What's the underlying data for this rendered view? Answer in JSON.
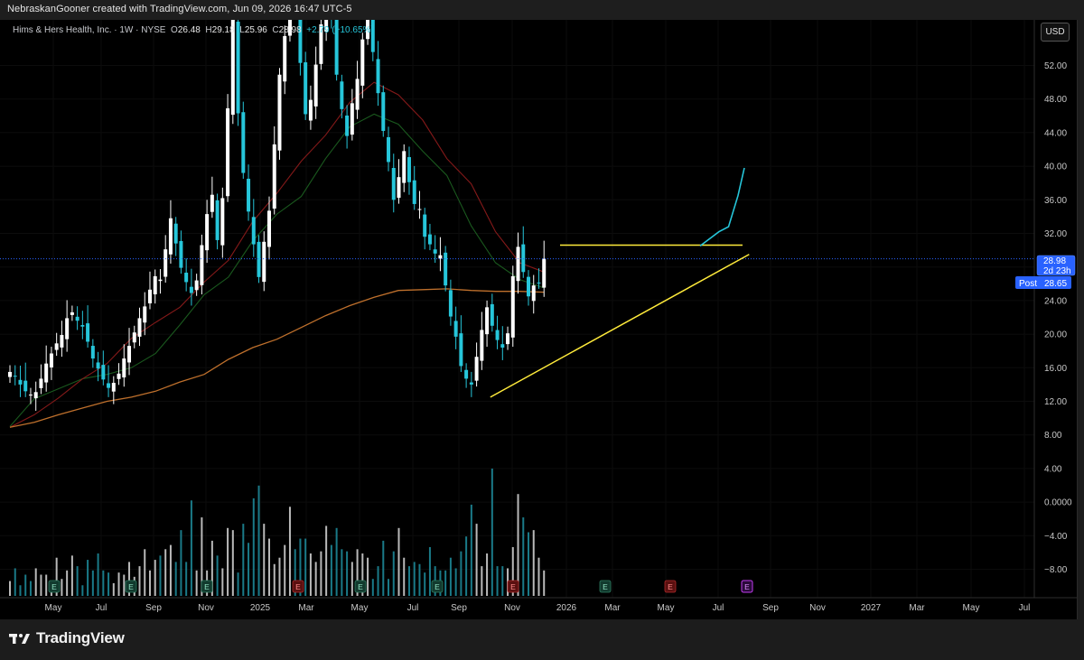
{
  "caption": "NebraskanGooner created with TradingView.com, Jun 09, 2026 16:47 UTC-5",
  "legend": {
    "symbol": "Hims & Hers Health, Inc. · 1W · NYSE",
    "o_label": "O",
    "o": "26.48",
    "h_label": "H",
    "h": "29.18",
    "l_label": "L",
    "l": "25.96",
    "c_label": "C",
    "c": "28.98",
    "change": "+2.79 (+10.65%)"
  },
  "currency_button": "USD",
  "brand": "TradingView",
  "colors": {
    "up_candle": "#ffffff",
    "down_candle": "#26c6da",
    "ema_fast": "#1b5e20",
    "ema_mid": "#8b1a1a",
    "ma_slow": "#c9762e",
    "trendline": "#ffeb3b",
    "projection": "#26c6da",
    "last_price_line": "#2962ff",
    "post_tag": "#2962ff"
  },
  "price_tags": {
    "last": "28.98",
    "countdown": "2d 23h",
    "post_label": "Post",
    "post": "28.65"
  },
  "earnings_marker": "E",
  "chart_data": {
    "type": "candlestick",
    "interval": "1W",
    "y_axis_ticks": [
      "52.00",
      "48.00",
      "44.00",
      "40.00",
      "36.00",
      "32.00",
      "28.00",
      "24.00",
      "20.00",
      "16.00",
      "12.00",
      "8.00",
      "4.00",
      "0.0000",
      "−4.00",
      "−8.00"
    ],
    "x_axis_ticks": [
      "May",
      "Jul",
      "Sep",
      "Nov",
      "2025",
      "Mar",
      "May",
      "Jul",
      "Sep",
      "Nov",
      "2026",
      "Mar",
      "May",
      "Jul",
      "Sep",
      "Nov",
      "2027",
      "Mar",
      "May",
      "Jul"
    ],
    "ylim": [
      6,
      56
    ],
    "last_close": 28.98,
    "post_market": 28.65,
    "resistance_level": 30.6,
    "support_trendline": [
      {
        "week": 93,
        "price": 12.5
      },
      {
        "week": 118,
        "price": 29.5
      }
    ],
    "projection_path": [
      [
        111,
        30.5
      ],
      [
        114,
        32.2
      ],
      [
        115.5,
        32.8
      ],
      [
        117,
        36.5
      ],
      [
        118,
        39.8
      ]
    ],
    "weekly_closes": [
      15.5,
      15.0,
      14.0,
      13.2,
      12.8,
      13.1,
      14.7,
      16.5,
      17.7,
      18.9,
      19.9,
      21.9,
      22.6,
      21.6,
      20.9,
      19.1,
      17.1,
      15.9,
      14.6,
      13.6,
      14.2,
      15.3,
      17.1,
      18.6,
      20.2,
      21.9,
      23.3,
      25.3,
      26.9,
      26.5,
      30.1,
      33.8,
      30.8,
      27.9,
      26.2,
      24.9,
      26.4,
      30.6,
      34.3,
      36.6,
      31.2,
      36.2,
      46.9,
      58.1,
      46.3,
      39.2,
      34.6,
      30.7,
      26.8,
      31.0,
      34.7,
      42.6,
      50.9,
      55.5,
      62.6,
      58.7,
      52.3,
      46.2,
      47.9,
      52.1,
      56.9,
      62.6,
      57.9,
      50.9,
      46.8,
      43.6,
      47.5,
      50.4,
      55.1,
      59.7,
      53.6,
      48.7,
      44.2,
      40.5,
      36.0,
      38.7,
      41.8,
      38.1,
      35.5,
      34.9,
      31.6,
      30.7,
      29.6,
      29.4,
      25.8,
      22.1,
      19.7,
      16.2,
      14.7,
      14.0,
      17.3,
      20.5,
      23.2,
      21.0,
      19.3,
      18.4,
      20.1,
      26.9,
      30.4,
      27.4,
      24.5,
      25.8,
      26.1,
      28.98
    ],
    "series": [
      {
        "values": [
          9.0,
          12.3,
          13.5,
          14.7,
          15.2,
          16.0,
          17.7,
          21.1,
          24.7,
          26.8,
          31.1,
          34.3,
          36.4,
          40.9,
          44.7,
          46.2,
          45.0,
          41.8,
          38.9,
          32.9,
          28.5,
          26.5,
          25.5
        ]
      },
      {
        "values": [
          8.9,
          10.4,
          12.4,
          14.7,
          16.5,
          19.5,
          21.4,
          23.2,
          26.2,
          28.8,
          33.4,
          36.8,
          40.6,
          43.7,
          47.6,
          50.0,
          48.5,
          45.5,
          40.9,
          37.9,
          32.2,
          28.5,
          27.4
        ]
      },
      {
        "values": [
          8.9,
          9.5,
          10.4,
          11.2,
          12.0,
          12.5,
          13.2,
          14.3,
          15.2,
          17.0,
          18.4,
          19.4,
          20.8,
          22.2,
          23.4,
          24.4,
          25.2,
          25.3,
          25.4,
          25.2,
          25.1,
          25.1,
          25.0
        ]
      }
    ],
    "earnings_weeks": [
      4,
      17,
      30,
      43,
      56,
      69,
      83,
      96,
      108
    ],
    "upcoming_earnings_week": 121,
    "volume_relative": [
      0.07,
      0.13,
      0.05,
      0.1,
      0.07,
      0.13,
      0.1,
      0.1,
      0.06,
      0.18,
      0.08,
      0.12,
      0.19,
      0.14,
      0.05,
      0.17,
      0.12,
      0.2,
      0.12,
      0.11,
      0.06,
      0.11,
      0.1,
      0.16,
      0.09,
      0.14,
      0.22,
      0.12,
      0.17,
      0.19,
      0.22,
      0.24,
      0.16,
      0.31,
      0.16,
      0.45,
      0.12,
      0.37,
      0.12,
      0.26,
      0.19,
      0.13,
      0.32,
      0.31,
      0.11,
      0.34,
      0.25,
      0.46,
      0.52,
      0.34,
      0.27,
      0.15,
      0.18,
      0.24,
      0.42,
      0.22,
      0.27,
      0.27,
      0.2,
      0.16,
      0.21,
      0.33,
      0.24,
      0.32,
      0.22,
      0.21,
      0.16,
      0.22,
      0.2,
      0.18,
      0.08,
      0.14,
      0.26,
      0.08,
      0.21,
      0.32,
      0.18,
      0.14,
      0.16,
      0.15,
      0.11,
      0.23,
      0.14,
      0.12,
      0.12,
      0.18,
      0.13,
      0.21,
      0.28,
      0.43,
      0.34,
      0.14,
      0.2,
      0.6,
      0.14,
      0.14,
      0.13,
      0.23,
      0.48,
      0.37,
      0.3,
      0.31,
      0.18,
      0.12
    ]
  }
}
